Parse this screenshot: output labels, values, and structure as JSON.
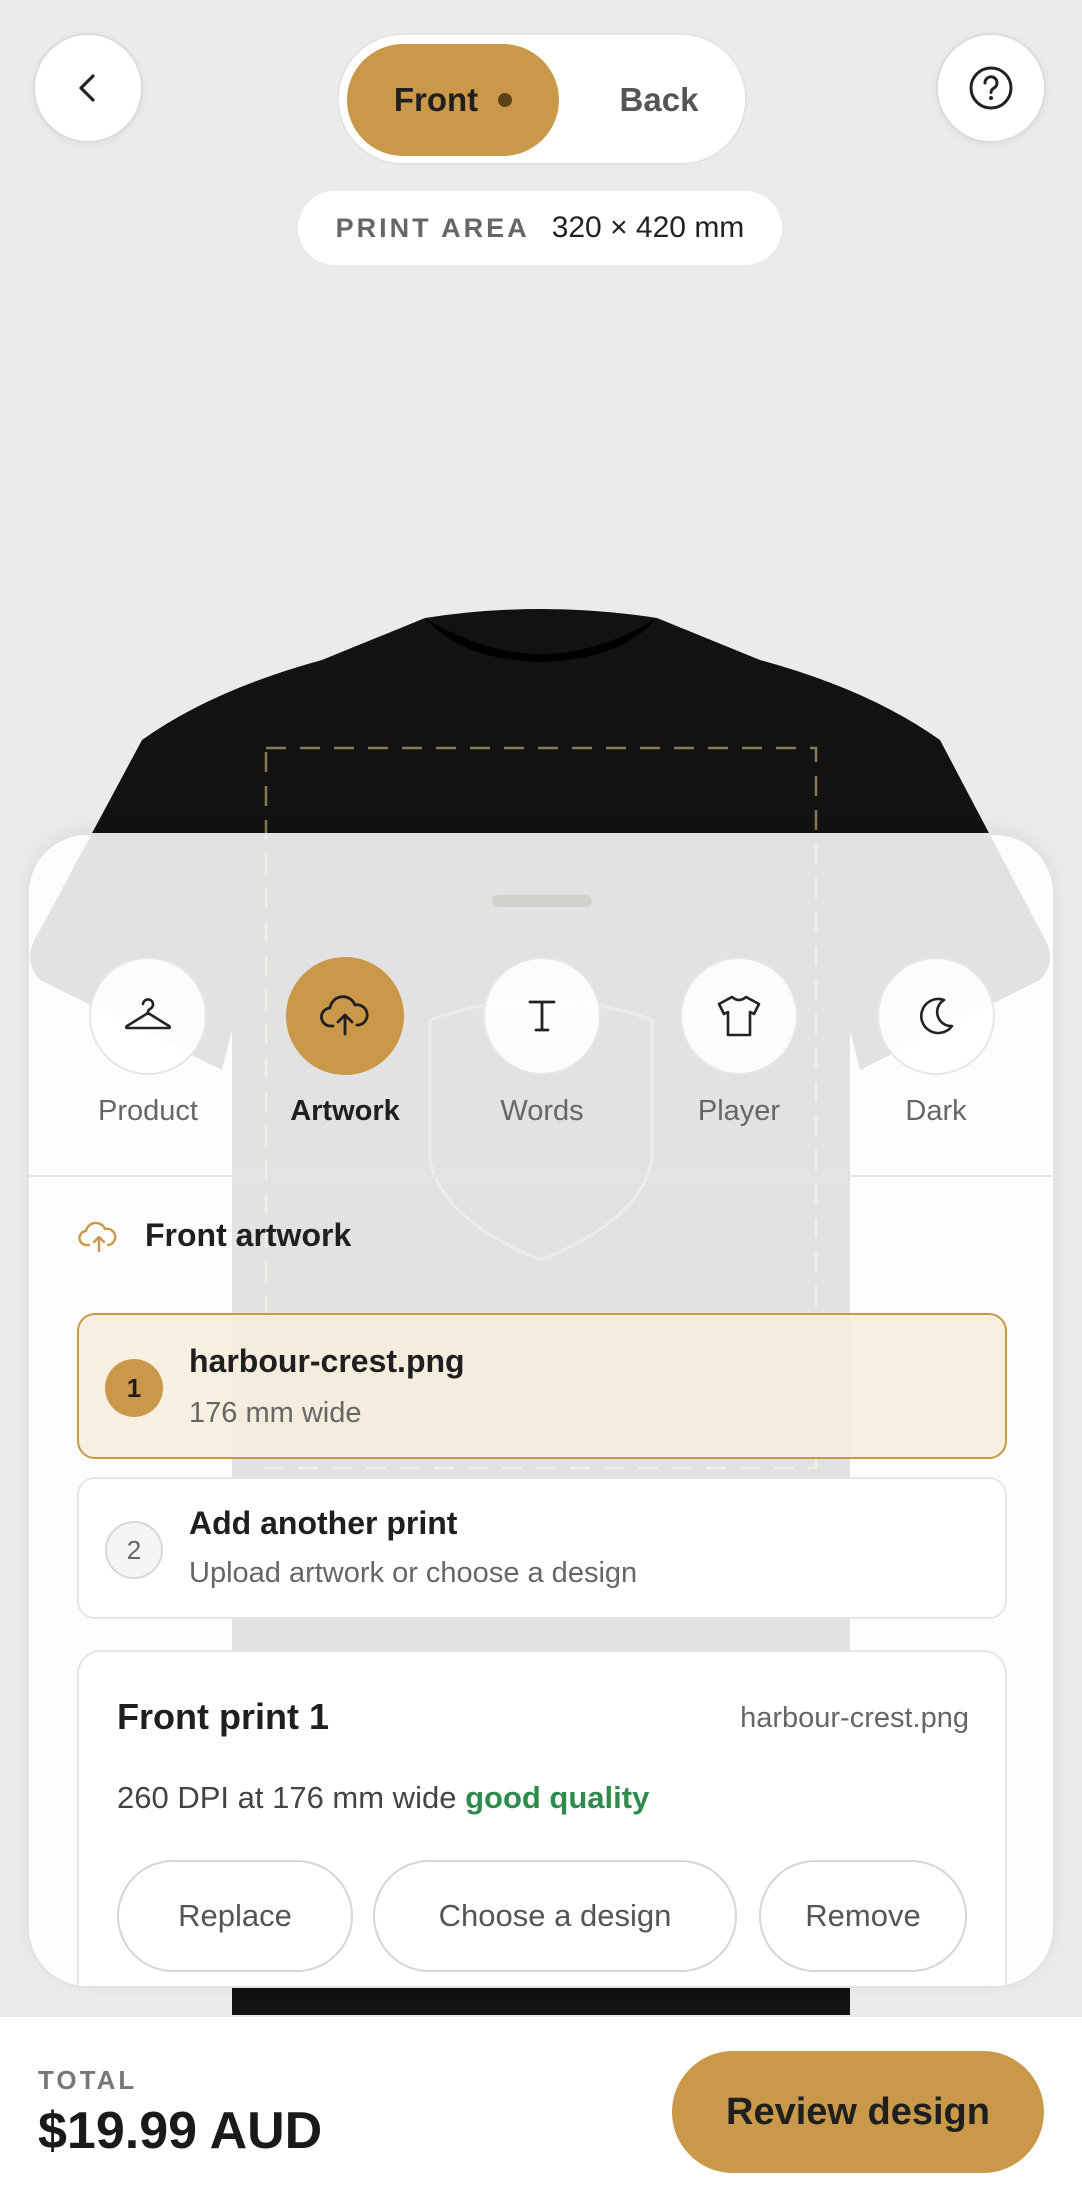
{
  "header": {
    "back_label": "Back",
    "side_toggle": {
      "front": "Front",
      "back": "Back",
      "selected": "Front"
    },
    "print_area": {
      "label": "PRINT AREA",
      "value": "320 × 420 mm"
    }
  },
  "tools": [
    {
      "label": "Product",
      "icon": "hanger-icon",
      "active": false
    },
    {
      "label": "Artwork",
      "icon": "cloud-upload-icon",
      "active": true
    },
    {
      "label": "Words",
      "icon": "text-icon",
      "active": false
    },
    {
      "label": "Player",
      "icon": "tshirt-icon",
      "active": false
    },
    {
      "label": "Dark",
      "icon": "moon-icon",
      "active": false
    }
  ],
  "artwork": {
    "section_title": "Front artwork",
    "items": [
      {
        "index": "1",
        "name": "harbour-crest.png",
        "detail": "176 mm wide",
        "selected": true
      },
      {
        "index": "2",
        "name": "Add another print",
        "detail": "Upload artwork or choose a design",
        "selected": false
      }
    ]
  },
  "print_card": {
    "title": "Front print 1",
    "file": "harbour-crest.png",
    "dpi_text": "260 DPI at 176 mm wide",
    "quality": "good quality",
    "actions": {
      "replace": "Replace",
      "choose": "Choose a design",
      "remove": "Remove"
    }
  },
  "footer": {
    "total_label": "TOTAL",
    "total_value": "$19.99 AUD",
    "review_label": "Review design"
  },
  "colors": {
    "accent": "#c99848",
    "good": "#2e8b4e",
    "background": "#ebebea"
  }
}
